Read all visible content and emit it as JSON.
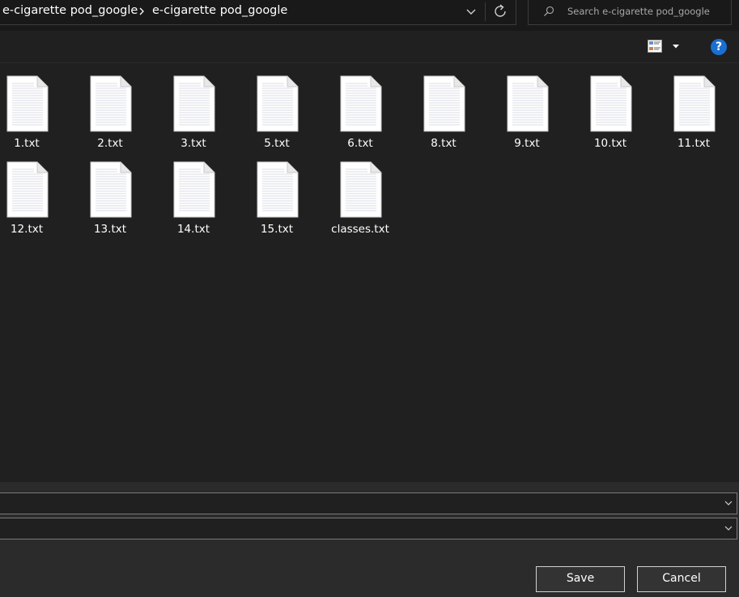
{
  "address_bar": {
    "breadcrumbs": [
      {
        "label": "e-cigarette pod_google"
      },
      {
        "label": "e-cigarette pod_google"
      }
    ]
  },
  "search": {
    "placeholder": "Search e-cigarette pod_google"
  },
  "toolbar": {
    "view_icon": "view-options-icon",
    "help_label": "?"
  },
  "files": [
    {
      "name": "1.txt"
    },
    {
      "name": "2.txt"
    },
    {
      "name": "3.txt"
    },
    {
      "name": "5.txt"
    },
    {
      "name": "6.txt"
    },
    {
      "name": "8.txt"
    },
    {
      "name": "9.txt"
    },
    {
      "name": "10.txt"
    },
    {
      "name": "11.txt"
    },
    {
      "name": "12.txt"
    },
    {
      "name": "13.txt"
    },
    {
      "name": "14.txt"
    },
    {
      "name": "15.txt"
    },
    {
      "name": "classes.txt"
    }
  ],
  "bottom": {
    "file_name_value": "",
    "file_type_value": "",
    "save_label": "Save",
    "cancel_label": "Cancel"
  },
  "colors": {
    "background": "#202020",
    "topbar": "#191919",
    "bottom_panel": "#2b2b2b",
    "help_accent": "#1a6fd1"
  }
}
